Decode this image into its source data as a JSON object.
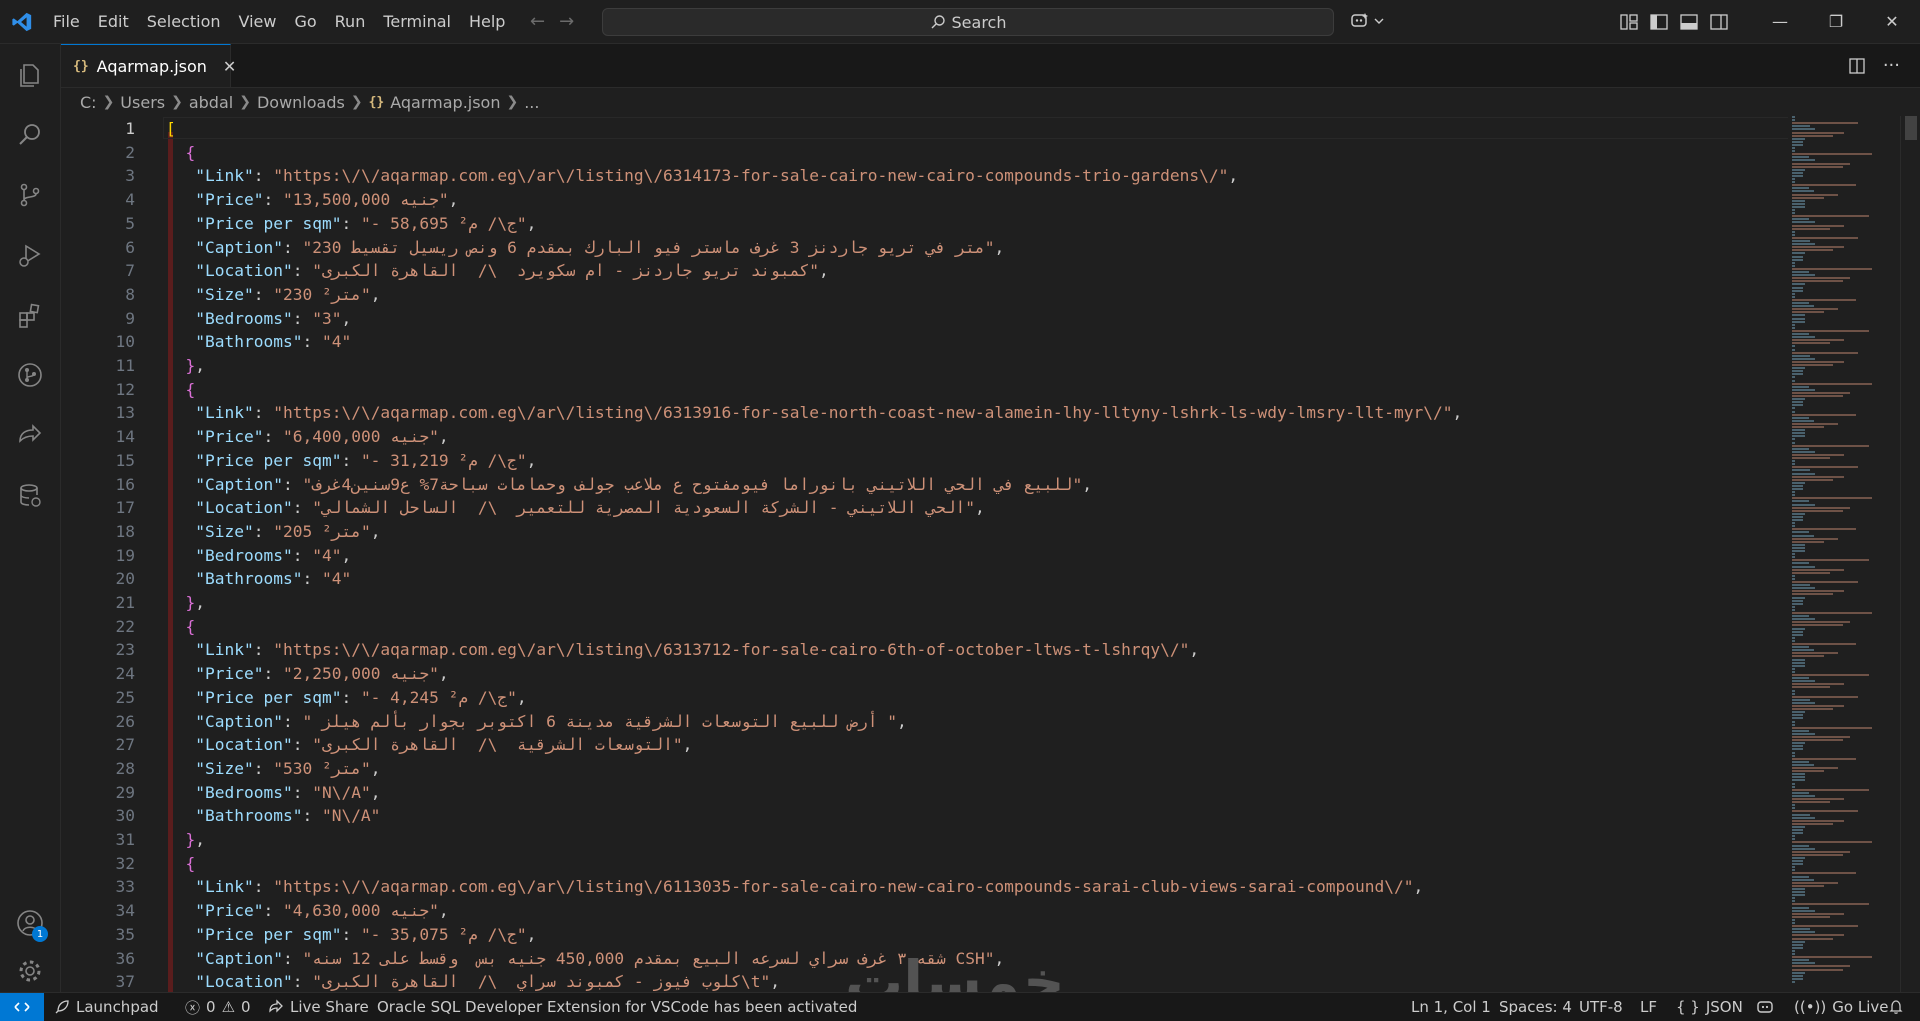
{
  "menu": [
    "File",
    "Edit",
    "Selection",
    "View",
    "Go",
    "Run",
    "Terminal",
    "Help"
  ],
  "search": {
    "label": "Search"
  },
  "tab": {
    "label": "Aqarmap.json"
  },
  "breadcrumb": [
    "C:",
    "Users",
    "abdal",
    "Downloads",
    "Aqarmap.json",
    "..."
  ],
  "editor": {
    "active_line": 1,
    "lines": [
      {
        "n": "1",
        "t": [
          [
            "b1",
            "["
          ]
        ]
      },
      {
        "n": "2",
        "t": [
          [
            "p",
            "  "
          ],
          [
            "b2",
            "{"
          ]
        ]
      },
      {
        "n": "3",
        "t": [
          [
            "p",
            "   "
          ],
          [
            "k",
            "\"Link\""
          ],
          [
            "p",
            ": "
          ],
          [
            "s",
            "\"https:\\/\\/aqarmap.com.eg\\/ar\\/listing\\/6314173-for-sale-cairo-new-cairo-compounds-trio-gardens\\/\""
          ],
          [
            "p",
            ","
          ]
        ]
      },
      {
        "n": "4",
        "t": [
          [
            "p",
            "   "
          ],
          [
            "k",
            "\"Price\""
          ],
          [
            "p",
            ": "
          ],
          [
            "s",
            "\"13,500,000 جنيه\""
          ],
          [
            "p",
            ","
          ]
        ]
      },
      {
        "n": "5",
        "t": [
          [
            "p",
            "   "
          ],
          [
            "k",
            "\"Price per sqm\""
          ],
          [
            "p",
            ": "
          ],
          [
            "s",
            "\"- 58,695 ج\\/ م²\""
          ],
          [
            "p",
            ","
          ]
        ]
      },
      {
        "n": "6",
        "t": [
          [
            "p",
            "   "
          ],
          [
            "k",
            "\"Caption\""
          ],
          [
            "p",
            ": "
          ],
          [
            "s",
            "\"متر في تريو جاردنز 3 غرف ماستر فيو البارك بمقدم 6 ونص ريسيل تقسيط 230\""
          ],
          [
            "p",
            ","
          ]
        ]
      },
      {
        "n": "7",
        "t": [
          [
            "p",
            "   "
          ],
          [
            "k",
            "\"Location\""
          ],
          [
            "p",
            ": "
          ],
          [
            "s",
            "\"كمبوند تريو جاردنز - ام سكويرد  \\/  القاهرة الكبرى\""
          ],
          [
            "p",
            ","
          ]
        ]
      },
      {
        "n": "8",
        "t": [
          [
            "p",
            "   "
          ],
          [
            "k",
            "\"Size\""
          ],
          [
            "p",
            ": "
          ],
          [
            "s",
            "\"230 متر²\""
          ],
          [
            "p",
            ","
          ]
        ]
      },
      {
        "n": "9",
        "t": [
          [
            "p",
            "   "
          ],
          [
            "k",
            "\"Bedrooms\""
          ],
          [
            "p",
            ": "
          ],
          [
            "s",
            "\"3\""
          ],
          [
            "p",
            ","
          ]
        ]
      },
      {
        "n": "10",
        "t": [
          [
            "p",
            "   "
          ],
          [
            "k",
            "\"Bathrooms\""
          ],
          [
            "p",
            ": "
          ],
          [
            "s",
            "\"4\""
          ]
        ]
      },
      {
        "n": "11",
        "t": [
          [
            "p",
            "  "
          ],
          [
            "b2",
            "}"
          ],
          [
            "p",
            ","
          ]
        ]
      },
      {
        "n": "12",
        "t": [
          [
            "p",
            "  "
          ],
          [
            "b2",
            "{"
          ]
        ]
      },
      {
        "n": "13",
        "t": [
          [
            "p",
            "   "
          ],
          [
            "k",
            "\"Link\""
          ],
          [
            "p",
            ": "
          ],
          [
            "s",
            "\"https:\\/\\/aqarmap.com.eg\\/ar\\/listing\\/6313916-for-sale-north-coast-new-alamein-lhy-lltyny-lshrk-ls-wdy-lmsry-llt-myr\\/\""
          ],
          [
            "p",
            ","
          ]
        ]
      },
      {
        "n": "14",
        "t": [
          [
            "p",
            "   "
          ],
          [
            "k",
            "\"Price\""
          ],
          [
            "p",
            ": "
          ],
          [
            "s",
            "\"6,400,000 جنيه\""
          ],
          [
            "p",
            ","
          ]
        ]
      },
      {
        "n": "15",
        "t": [
          [
            "p",
            "   "
          ],
          [
            "k",
            "\"Price per sqm\""
          ],
          [
            "p",
            ": "
          ],
          [
            "s",
            "\"- 31,219 ج\\/ م²\""
          ],
          [
            "p",
            ","
          ]
        ]
      },
      {
        "n": "16",
        "t": [
          [
            "p",
            "   "
          ],
          [
            "k",
            "\"Caption\""
          ],
          [
            "p",
            ": "
          ],
          [
            "s",
            "\"للبيع في الحي اللاتيني بانوراما فيومفتوح ع ملاعب جولف وحمامات سباحة7% ع9سنين4غرف\""
          ],
          [
            "p",
            ","
          ]
        ]
      },
      {
        "n": "17",
        "t": [
          [
            "p",
            "   "
          ],
          [
            "k",
            "\"Location\""
          ],
          [
            "p",
            ": "
          ],
          [
            "s",
            "\"الحي اللاتيني - الشركة السعودية المصرية للتعمير  \\/  الساحل الشمالي\""
          ],
          [
            "p",
            ","
          ]
        ]
      },
      {
        "n": "18",
        "t": [
          [
            "p",
            "   "
          ],
          [
            "k",
            "\"Size\""
          ],
          [
            "p",
            ": "
          ],
          [
            "s",
            "\"205 متر²\""
          ],
          [
            "p",
            ","
          ]
        ]
      },
      {
        "n": "19",
        "t": [
          [
            "p",
            "   "
          ],
          [
            "k",
            "\"Bedrooms\""
          ],
          [
            "p",
            ": "
          ],
          [
            "s",
            "\"4\""
          ],
          [
            "p",
            ","
          ]
        ]
      },
      {
        "n": "20",
        "t": [
          [
            "p",
            "   "
          ],
          [
            "k",
            "\"Bathrooms\""
          ],
          [
            "p",
            ": "
          ],
          [
            "s",
            "\"4\""
          ]
        ]
      },
      {
        "n": "21",
        "t": [
          [
            "p",
            "  "
          ],
          [
            "b2",
            "}"
          ],
          [
            "p",
            ","
          ]
        ]
      },
      {
        "n": "22",
        "t": [
          [
            "p",
            "  "
          ],
          [
            "b2",
            "{"
          ]
        ]
      },
      {
        "n": "23",
        "t": [
          [
            "p",
            "   "
          ],
          [
            "k",
            "\"Link\""
          ],
          [
            "p",
            ": "
          ],
          [
            "s",
            "\"https:\\/\\/aqarmap.com.eg\\/ar\\/listing\\/6313712-for-sale-cairo-6th-of-october-ltws-t-lshrqy\\/\""
          ],
          [
            "p",
            ","
          ]
        ]
      },
      {
        "n": "24",
        "t": [
          [
            "p",
            "   "
          ],
          [
            "k",
            "\"Price\""
          ],
          [
            "p",
            ": "
          ],
          [
            "s",
            "\"2,250,000 جنيه\""
          ],
          [
            "p",
            ","
          ]
        ]
      },
      {
        "n": "25",
        "t": [
          [
            "p",
            "   "
          ],
          [
            "k",
            "\"Price per sqm\""
          ],
          [
            "p",
            ": "
          ],
          [
            "s",
            "\"- 4,245 ج\\/ م²\""
          ],
          [
            "p",
            ","
          ]
        ]
      },
      {
        "n": "26",
        "t": [
          [
            "p",
            "   "
          ],
          [
            "k",
            "\"Caption\""
          ],
          [
            "p",
            ": "
          ],
          [
            "s",
            "\" أرض للبيع التوسعات الشرقية مدينة 6 اكتوبر بجوار بألم هيلز \""
          ],
          [
            "p",
            ","
          ]
        ]
      },
      {
        "n": "27",
        "t": [
          [
            "p",
            "   "
          ],
          [
            "k",
            "\"Location\""
          ],
          [
            "p",
            ": "
          ],
          [
            "s",
            "\"التوسعات الشرقية  \\/  القاهرة الكبرى\""
          ],
          [
            "p",
            ","
          ]
        ]
      },
      {
        "n": "28",
        "t": [
          [
            "p",
            "   "
          ],
          [
            "k",
            "\"Size\""
          ],
          [
            "p",
            ": "
          ],
          [
            "s",
            "\"530 متر²\""
          ],
          [
            "p",
            ","
          ]
        ]
      },
      {
        "n": "29",
        "t": [
          [
            "p",
            "   "
          ],
          [
            "k",
            "\"Bedrooms\""
          ],
          [
            "p",
            ": "
          ],
          [
            "s",
            "\"N\\/A\""
          ],
          [
            "p",
            ","
          ]
        ]
      },
      {
        "n": "30",
        "t": [
          [
            "p",
            "   "
          ],
          [
            "k",
            "\"Bathrooms\""
          ],
          [
            "p",
            ": "
          ],
          [
            "s",
            "\"N\\/A\""
          ]
        ]
      },
      {
        "n": "31",
        "t": [
          [
            "p",
            "  "
          ],
          [
            "b2",
            "}"
          ],
          [
            "p",
            ","
          ]
        ]
      },
      {
        "n": "32",
        "t": [
          [
            "p",
            "  "
          ],
          [
            "b2",
            "{"
          ]
        ]
      },
      {
        "n": "33",
        "t": [
          [
            "p",
            "   "
          ],
          [
            "k",
            "\"Link\""
          ],
          [
            "p",
            ": "
          ],
          [
            "s",
            "\"https:\\/\\/aqarmap.com.eg\\/ar\\/listing\\/6113035-for-sale-cairo-new-cairo-compounds-sarai-club-views-sarai-compound\\/\""
          ],
          [
            "p",
            ","
          ]
        ]
      },
      {
        "n": "34",
        "t": [
          [
            "p",
            "   "
          ],
          [
            "k",
            "\"Price\""
          ],
          [
            "p",
            ": "
          ],
          [
            "s",
            "\"4,630,000 جنيه\""
          ],
          [
            "p",
            ","
          ]
        ]
      },
      {
        "n": "35",
        "t": [
          [
            "p",
            "   "
          ],
          [
            "k",
            "\"Price per sqm\""
          ],
          [
            "p",
            ": "
          ],
          [
            "s",
            "\"- 35,075 ج\\/ م²\""
          ],
          [
            "p",
            ","
          ]
        ]
      },
      {
        "n": "36",
        "t": [
          [
            "p",
            "   "
          ],
          [
            "k",
            "\"Caption\""
          ],
          [
            "p",
            ": "
          ],
          [
            "s",
            "\"شقه ٣ غرف سراي لسرعه البيع بمقدم 450,000 جنيه بس  وقسط على 12 سنه CSH\""
          ],
          [
            "p",
            ","
          ]
        ]
      },
      {
        "n": "37",
        "t": [
          [
            "p",
            "   "
          ],
          [
            "k",
            "\"Location\""
          ],
          [
            "p",
            ": "
          ],
          [
            "s",
            "\"كلوب فيوز - كمبوند سراي  \\/  القاهرة الكبرى\\t\""
          ],
          [
            "p",
            ","
          ]
        ]
      }
    ]
  },
  "watermark": "خمسات",
  "status": {
    "launchpad": "Launchpad",
    "errors": "0",
    "warnings": "0",
    "live_share": "Live Share",
    "message": "Oracle SQL Developer Extension for VSCode has been activated",
    "cursor": "Ln 1, Col 1",
    "spaces": "Spaces: 4",
    "encoding": "UTF-8",
    "eol": "LF",
    "language": "JSON",
    "go_live": "Go Live"
  },
  "accounts_badge": "1",
  "colors": {
    "accent": "#0078d4",
    "key": "#9cdcfe",
    "string": "#ce9178",
    "bracket1": "#ffd700",
    "bracket2": "#da70d6"
  }
}
